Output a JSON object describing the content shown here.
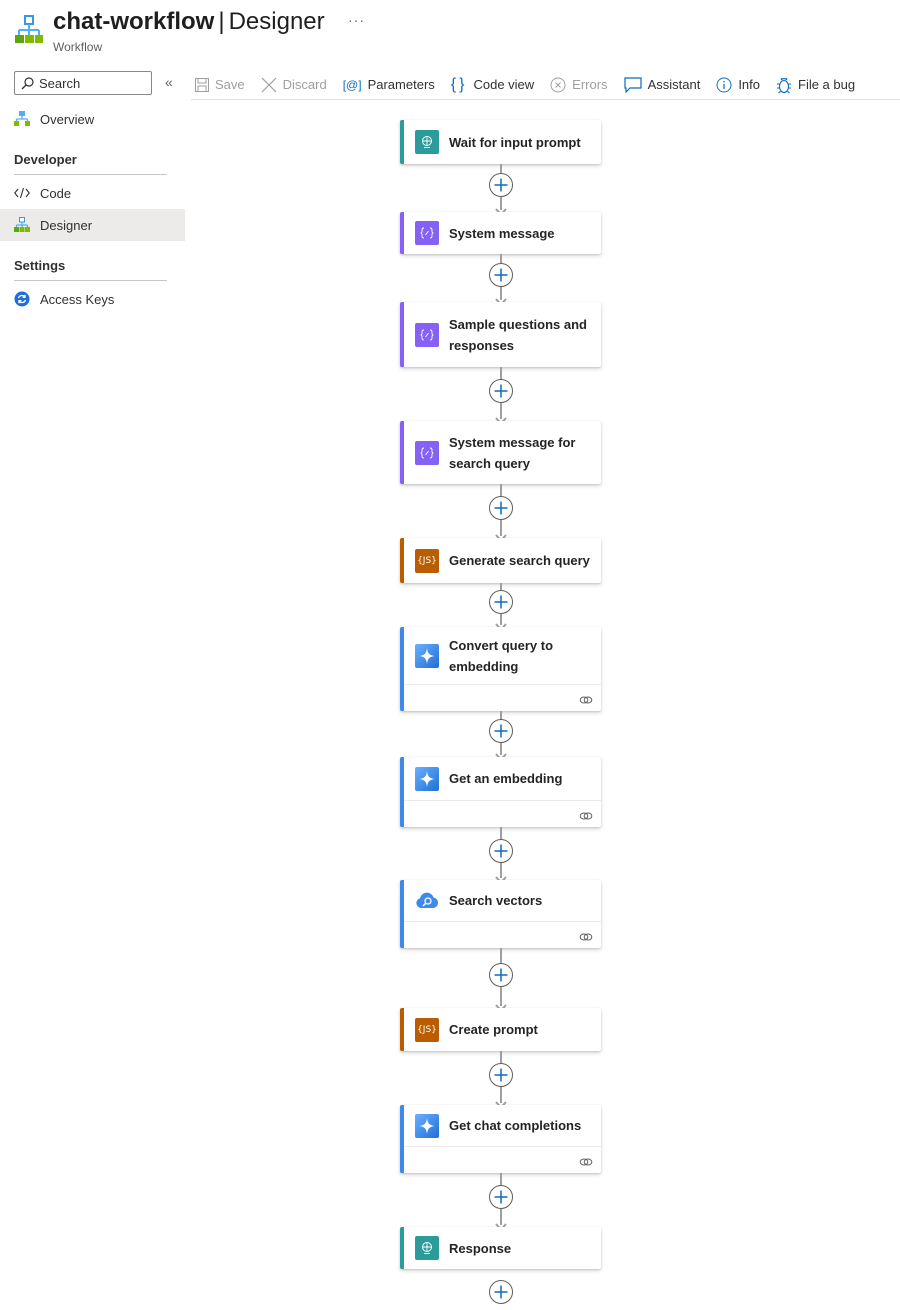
{
  "header": {
    "resource_name": "chat-workflow",
    "separator": "|",
    "page_name": "Designer",
    "subtitle": "Workflow",
    "more_label": "···"
  },
  "sidebar": {
    "search_placeholder": "Search",
    "collapse_label": "«",
    "overview_label": "Overview",
    "sections": [
      {
        "title": "Developer",
        "items": [
          {
            "label": "Code",
            "icon": "code-icon"
          },
          {
            "label": "Designer",
            "icon": "workflow-icon",
            "active": true
          }
        ]
      },
      {
        "title": "Settings",
        "items": [
          {
            "label": "Access Keys",
            "icon": "key-refresh-icon"
          }
        ]
      }
    ]
  },
  "toolbar": {
    "items": [
      {
        "label": "Save",
        "icon": "save-icon",
        "disabled": true
      },
      {
        "label": "Discard",
        "icon": "discard-icon",
        "disabled": true
      },
      {
        "label": "Parameters",
        "icon": "parameters-icon",
        "disabled": false
      },
      {
        "label": "Code view",
        "icon": "code-view-icon",
        "disabled": false
      },
      {
        "label": "Errors",
        "icon": "errors-icon",
        "disabled": true
      },
      {
        "label": "Assistant",
        "icon": "assistant-icon",
        "disabled": false
      },
      {
        "label": "Info",
        "icon": "info-icon",
        "disabled": false
      },
      {
        "label": "File a bug",
        "icon": "bug-icon",
        "disabled": false
      }
    ]
  },
  "colors": {
    "request": "#2b9c9b",
    "variable": "#8661f5",
    "javascript": "#ba5c00",
    "openai": "#3f8ae8",
    "search": "#3f8ae8",
    "accent": "#0f6cbd"
  },
  "workflow": {
    "steps": [
      {
        "title": "Wait for input prompt",
        "type": "request",
        "icon": "http-request-icon",
        "connection": false
      },
      {
        "title": "System message",
        "type": "variable",
        "icon": "variable-icon",
        "connection": false
      },
      {
        "title": "Sample questions and responses",
        "type": "variable",
        "icon": "variable-icon",
        "connection": false
      },
      {
        "title": "System message for search query",
        "type": "variable",
        "icon": "variable-icon",
        "connection": false
      },
      {
        "title": "Generate search query",
        "type": "javascript",
        "icon": "javascript-icon",
        "connection": false
      },
      {
        "title": "Convert query to embedding",
        "type": "openai",
        "icon": "azure-openai-icon",
        "connection": true
      },
      {
        "title": "Get an embedding",
        "type": "openai",
        "icon": "azure-openai-icon",
        "connection": true
      },
      {
        "title": "Search vectors",
        "type": "search",
        "icon": "ai-search-icon",
        "connection": true
      },
      {
        "title": "Create prompt",
        "type": "javascript",
        "icon": "javascript-icon",
        "connection": false
      },
      {
        "title": "Get chat completions",
        "type": "openai",
        "icon": "azure-openai-icon",
        "connection": true
      },
      {
        "title": "Response",
        "type": "request",
        "icon": "http-request-icon",
        "connection": false
      }
    ]
  }
}
